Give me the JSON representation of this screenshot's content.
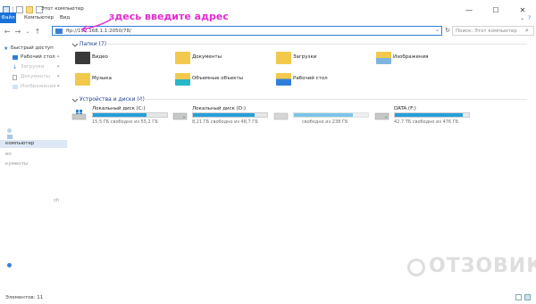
{
  "window": {
    "title": "Этот компьютер",
    "buttons": {
      "minimize": "—",
      "maximize": "☐",
      "close": "✕"
    }
  },
  "menu": {
    "file": "Файл",
    "computer": "Компьютер",
    "view": "Вид"
  },
  "address": {
    "value": "ftp://192.168.1.1:2050/78/",
    "search_placeholder": "Поиск: Этот компьютер"
  },
  "annotation": "здесь введите адрес",
  "sidebar": {
    "items": [
      {
        "label": "Быстрый доступ",
        "pinned": false
      },
      {
        "label": "Рабочий стол",
        "pinned": true
      },
      {
        "label": "Загрузки",
        "pinned": true
      },
      {
        "label": "Документы",
        "pinned": true
      },
      {
        "label": "Изображения",
        "pinned": true
      },
      {
        "label": "компьютер",
        "selected": true
      },
      {
        "label": "ео",
        "pinned": false
      },
      {
        "label": "кументы",
        "pinned": false
      },
      {
        "label": "ch",
        "pinned": false
      }
    ]
  },
  "folders": {
    "header": "Папки (7)",
    "items": [
      {
        "label": "Видео",
        "icon": "video-folder-icon"
      },
      {
        "label": "Документы",
        "icon": "documents-folder-icon"
      },
      {
        "label": "Загрузки",
        "icon": "downloads-folder-icon"
      },
      {
        "label": "Изображения",
        "icon": "pictures-folder-icon"
      },
      {
        "label": "Музыка",
        "icon": "music-folder-icon"
      },
      {
        "label": "Объемные объекты",
        "icon": "3d-objects-folder-icon"
      },
      {
        "label": "Рабочий стол",
        "icon": "desktop-folder-icon"
      }
    ]
  },
  "drives": {
    "header": "Устройства и диски (4)",
    "items": [
      {
        "label": "Локальный диск (C:)",
        "free": "15,5 ГБ свободно из 55,2 ГБ",
        "used_fraction": 0.72,
        "icon": "windows-drive-icon"
      },
      {
        "label": "Локальный диск (D:)",
        "free": "8,21 ГБ свободно из 48,7 ГБ",
        "used_fraction": 0.83,
        "icon": "hard-drive-icon"
      },
      {
        "label": "",
        "free": "свободно из 238 ГБ",
        "used_fraction": 0.8,
        "icon": "hard-drive-icon"
      },
      {
        "label": "DATA (F:)",
        "free": "42,7 ТБ свободно из 476 ГБ",
        "used_fraction": 0.91,
        "icon": "hard-drive-icon"
      }
    ]
  },
  "status": {
    "count": "Элементов: 11"
  },
  "watermark": "ОТЗОВИК",
  "colors": {
    "accent": "#1a73d9",
    "bar_fill": "#26a0da",
    "annotation": "#e32bd1",
    "group_header": "#1e3d8f"
  }
}
